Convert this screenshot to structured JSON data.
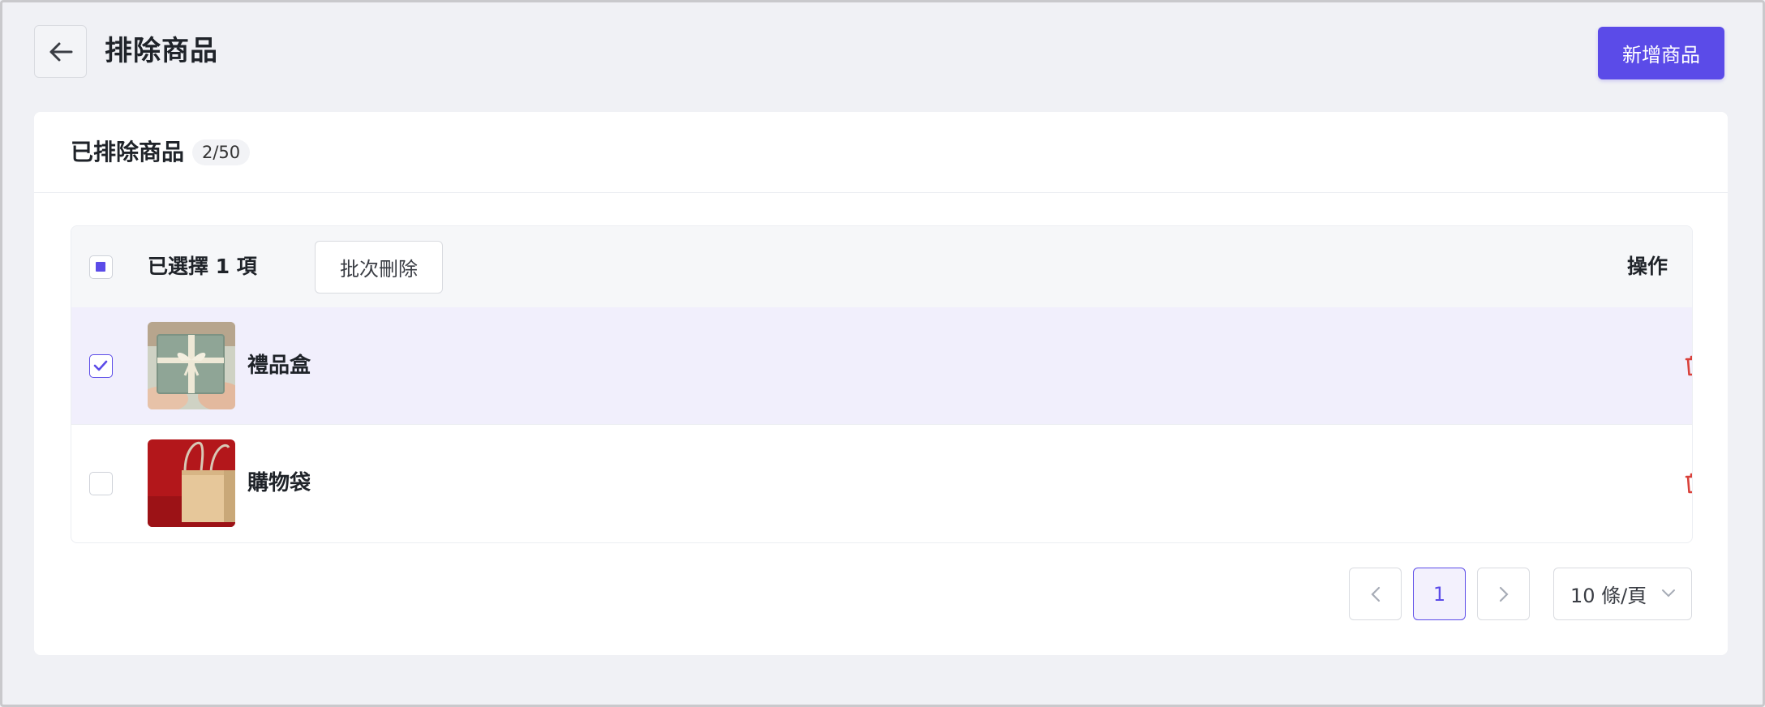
{
  "header": {
    "title": "排除商品",
    "add_button_label": "新增商品"
  },
  "card": {
    "title": "已排除商品",
    "count_badge": "2/50"
  },
  "table": {
    "selection_text": "已選擇 1 項",
    "batch_delete_label": "批次刪除",
    "operation_header": "操作",
    "rows": [
      {
        "name": "禮品盒",
        "selected": true,
        "thumbnail": "gift-box-image"
      },
      {
        "name": "購物袋",
        "selected": false,
        "thumbnail": "shopping-bag-image"
      }
    ]
  },
  "pagination": {
    "prev_icon": "chevron-left-icon",
    "current_page": "1",
    "next_icon": "chevron-right-icon",
    "page_size_label": "10 條/頁"
  },
  "colors": {
    "accent": "#5b4be8",
    "delete": "#d9413a",
    "selected_row": "#f1effc"
  }
}
